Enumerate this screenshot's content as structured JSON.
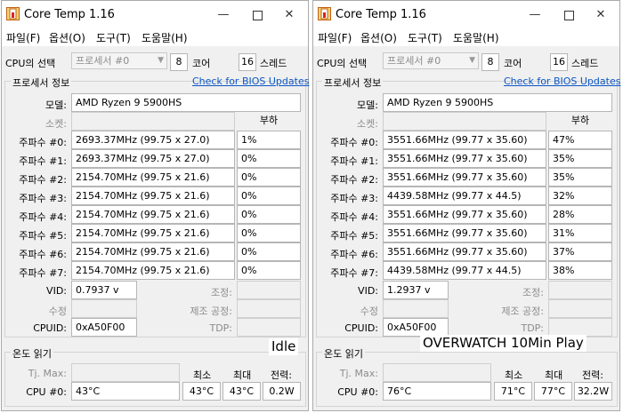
{
  "windows": [
    {
      "title": "Core Temp 1.16",
      "menu": [
        "파일(F)",
        "옵션(O)",
        "도구(T)",
        "도움말(H)"
      ],
      "cpu_select": {
        "label": "CPU의 선택",
        "combo": "프로세서 #0",
        "cores_value": "8",
        "cores_label": "코어",
        "threads_value": "16",
        "threads_label": "스레드"
      },
      "processor_info": {
        "title": "프로세서 정보",
        "bios_link": "Check for BIOS Updates"
      },
      "model": {
        "label": "모델:",
        "value": "AMD Ryzen 9 5900HS"
      },
      "socket": {
        "label": "소켓:",
        "value": ""
      },
      "load_header": "부하",
      "freqs": [
        {
          "label": "주파수 #0:",
          "value": "2693.37MHz (99.75 x 27.0)",
          "load": "1%"
        },
        {
          "label": "주파수 #1:",
          "value": "2693.37MHz (99.75 x 27.0)",
          "load": "0%"
        },
        {
          "label": "주파수 #2:",
          "value": "2154.70MHz (99.75 x 21.6)",
          "load": "0%"
        },
        {
          "label": "주파수 #3:",
          "value": "2154.70MHz (99.75 x 21.6)",
          "load": "0%"
        },
        {
          "label": "주파수 #4:",
          "value": "2154.70MHz (99.75 x 21.6)",
          "load": "0%"
        },
        {
          "label": "주파수 #5:",
          "value": "2154.70MHz (99.75 x 21.6)",
          "load": "0%"
        },
        {
          "label": "주파수 #6:",
          "value": "2154.70MHz (99.75 x 21.6)",
          "load": "0%"
        },
        {
          "label": "주파수 #7:",
          "value": "2154.70MHz (99.75 x 21.6)",
          "load": "0%"
        }
      ],
      "vid": {
        "label": "VID:",
        "value": "0.7937 v"
      },
      "adjust_label": "조정:",
      "revision": {
        "label": "수정",
        "value": ""
      },
      "lithography_label": "제조 공정:",
      "cpuid": {
        "label": "CPUID:",
        "value": "0xA50F00"
      },
      "tdp_label": "TDP:",
      "temp": {
        "title": "온도 읽기",
        "tjmax_label": "Tj. Max:",
        "min_header": "최소",
        "max_header": "최대",
        "power_header": "전력:",
        "cpu_label": "CPU #0:",
        "cpu_value": "43°C",
        "min_value": "43°C",
        "max_value": "43°C",
        "power_value": "0.2W"
      },
      "overlay": "Idle"
    },
    {
      "title": "Core Temp 1.16",
      "menu": [
        "파일(F)",
        "옵션(O)",
        "도구(T)",
        "도움말(H)"
      ],
      "cpu_select": {
        "label": "CPU의 선택",
        "combo": "프로세서 #0",
        "cores_value": "8",
        "cores_label": "코어",
        "threads_value": "16",
        "threads_label": "스레드"
      },
      "processor_info": {
        "title": "프로세서 정보",
        "bios_link": "Check for BIOS Updates"
      },
      "model": {
        "label": "모델:",
        "value": "AMD Ryzen 9 5900HS"
      },
      "socket": {
        "label": "소켓:",
        "value": ""
      },
      "load_header": "부하",
      "freqs": [
        {
          "label": "주파수 #0:",
          "value": "3551.66MHz (99.77 x 35.60)",
          "load": "47%"
        },
        {
          "label": "주파수 #1:",
          "value": "3551.66MHz (99.77 x 35.60)",
          "load": "35%"
        },
        {
          "label": "주파수 #2:",
          "value": "3551.66MHz (99.77 x 35.60)",
          "load": "35%"
        },
        {
          "label": "주파수 #3:",
          "value": "4439.58MHz (99.77 x 44.5)",
          "load": "32%"
        },
        {
          "label": "주파수 #4:",
          "value": "3551.66MHz (99.77 x 35.60)",
          "load": "28%"
        },
        {
          "label": "주파수 #5:",
          "value": "3551.66MHz (99.77 x 35.60)",
          "load": "31%"
        },
        {
          "label": "주파수 #6:",
          "value": "3551.66MHz (99.77 x 35.60)",
          "load": "37%"
        },
        {
          "label": "주파수 #7:",
          "value": "4439.58MHz (99.77 x 44.5)",
          "load": "38%"
        }
      ],
      "vid": {
        "label": "VID:",
        "value": "1.2937 v"
      },
      "adjust_label": "조정:",
      "revision": {
        "label": "수정",
        "value": ""
      },
      "lithography_label": "제조 공정:",
      "cpuid": {
        "label": "CPUID:",
        "value": "0xA50F00"
      },
      "tdp_label": "TDP:",
      "temp": {
        "title": "온도 읽기",
        "tjmax_label": "Tj. Max:",
        "min_header": "최소",
        "max_header": "최대",
        "power_header": "전력:",
        "cpu_label": "CPU #0:",
        "cpu_value": "76°C",
        "min_value": "71°C",
        "max_value": "77°C",
        "power_value": "32.2W"
      },
      "overlay": "OVERWATCH 10Min Play"
    }
  ]
}
